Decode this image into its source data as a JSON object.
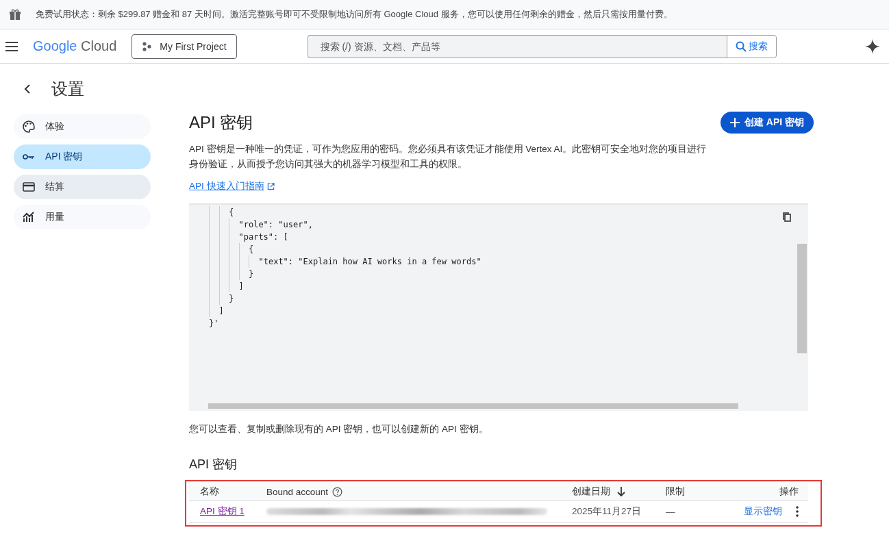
{
  "trial_banner": {
    "text": "免费试用状态：剩余 $299.87 赠金和 87 天时间。激活完整账号即可不受限制地访问所有 Google Cloud 服务，您可以使用任何剩余的赠金，然后只需按用量付费。"
  },
  "header": {
    "logo": {
      "brand": "Google",
      "product": "Cloud"
    },
    "project": "My First Project",
    "search": {
      "placeholder": "搜索 (/) 资源、文档、产品等",
      "button": "搜索"
    }
  },
  "page": {
    "title": "设置"
  },
  "sidebar": {
    "items": [
      {
        "label": "体验",
        "kind": "palette",
        "selected": false
      },
      {
        "label": "API 密钥",
        "kind": "key",
        "selected": true
      },
      {
        "label": "结算",
        "kind": "card",
        "selected": false
      },
      {
        "label": "用量",
        "kind": "chart",
        "selected": false
      }
    ]
  },
  "main": {
    "title": "API 密钥",
    "create_button": "创建 API 密钥",
    "description": "API 密钥是一种唯一的凭证，可作为您应用的密码。您必须具有该凭证才能使用 Vertex AI。此密钥可安全地对您的项目进行身份验证，从而授予您访问其强大的机器学习模型和工具的权限。",
    "guide_link": "API 快速入门指南",
    "code_lines": [
      "    {",
      "      \"role\": \"user\",",
      "      \"parts\": [",
      "        {",
      "          \"text\": \"Explain how AI works in a few words\"",
      "        }",
      "      ]",
      "    }",
      "  ]",
      "}'"
    ],
    "manage_text": "您可以查看、复制或删除现有的 API 密钥，也可以创建新的 API 密钥。",
    "keys_heading": "API 密钥",
    "table": {
      "columns": [
        "名称",
        "Bound account",
        "创建日期",
        "限制",
        "操作"
      ],
      "rows": [
        {
          "name": "API 密钥 1",
          "created": "2025年11月27日",
          "restriction": "—",
          "action": "显示密钥"
        }
      ]
    },
    "highlighted": true
  }
}
